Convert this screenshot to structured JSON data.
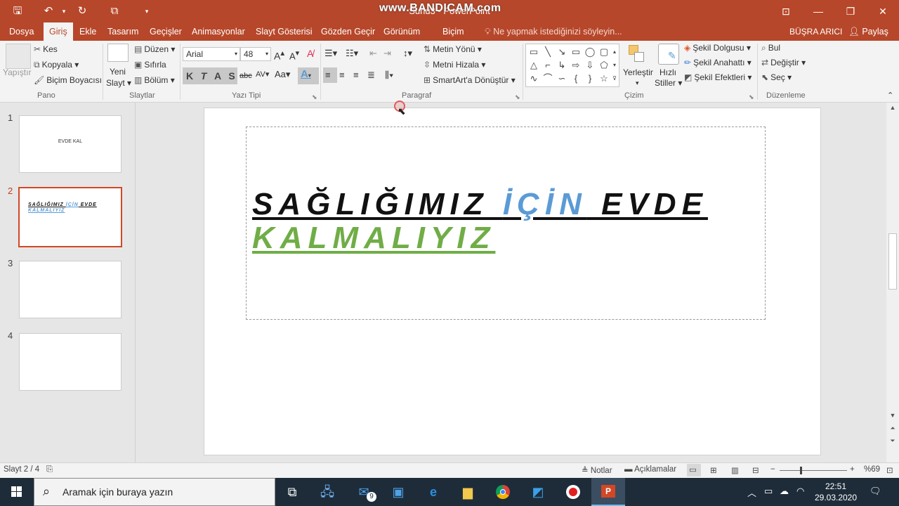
{
  "titlebar": {
    "title": "Sunu3 - PowerPoint",
    "watermark": "www.BANDICAM.com"
  },
  "tabs": [
    {
      "label": "Dosya",
      "active": false
    },
    {
      "label": "Giriş",
      "active": true
    },
    {
      "label": "Ekle",
      "active": false
    },
    {
      "label": "Tasarım",
      "active": false
    },
    {
      "label": "Geçişler",
      "active": false
    },
    {
      "label": "Animasyonlar",
      "active": false
    },
    {
      "label": "Slayt Gösterisi",
      "active": false
    },
    {
      "label": "Gözden Geçir",
      "active": false
    },
    {
      "label": "Görünüm",
      "active": false
    },
    {
      "label": "Biçim",
      "active": false
    }
  ],
  "tellme": "Ne yapmak istediğinizi söyleyin...",
  "user": "BÜŞRA ARICI",
  "share": "Paylaş",
  "ribbon": {
    "pano": {
      "paste": "Yapıştır",
      "cut": "Kes",
      "copy": "Kopyala",
      "format_painter": "Biçim Boyacısı",
      "label": "Pano"
    },
    "slaytlar": {
      "new_slide_1": "Yeni",
      "new_slide_2": "Slayt",
      "layout": "Düzen",
      "reset": "Sıfırla",
      "section": "Bölüm",
      "label": "Slaytlar"
    },
    "yazi_tipi": {
      "font_name": "Arial",
      "font_size": "48",
      "bold": "K",
      "italic": "T",
      "underline": "A",
      "shadow": "S",
      "strike": "abc",
      "spacing": "AV",
      "case": "Aa",
      "font_color": "A",
      "label": "Yazı Tipi"
    },
    "paragraf": {
      "text_direction": "Metin Yönü",
      "align_text": "Metni Hizala",
      "smartart": "SmartArt'a Dönüştür",
      "label": "Paragraf"
    },
    "cizim": {
      "arrange": "Yerleştir",
      "quick_styles_1": "Hızlı",
      "quick_styles_2": "Stiller",
      "shape_fill": "Şekil Dolgusu",
      "shape_outline": "Şekil Anahattı",
      "shape_effects": "Şekil Efektleri",
      "label": "Çizim"
    },
    "duzenleme": {
      "find": "Bul",
      "replace": "Değiştir",
      "select": "Seç",
      "label": "Düzenleme"
    }
  },
  "slides": [
    {
      "number": "1",
      "text": "EVDE KAL"
    },
    {
      "number": "2",
      "line1_black": "SAĞLIĞIMIZ ",
      "line1_blue": "İÇİN",
      "line1_end": " EVDE",
      "line2": "KALMALIYIZ"
    },
    {
      "number": "3"
    },
    {
      "number": "4"
    }
  ],
  "main_slide": {
    "part1": "SAĞLIĞIMIZ ",
    "part2": "İÇİN",
    "part3": " EVDE",
    "line2": "KALMALIYIZ"
  },
  "status": {
    "slide_info": "Slayt 2 / 4",
    "notes": "Notlar",
    "comments": "Açıklamalar",
    "zoom": "%69"
  },
  "taskbar": {
    "search_placeholder": "Aramak için buraya yazın",
    "mail_badge": "9",
    "time": "22:51",
    "date": "29.03.2020"
  },
  "colors": {
    "accent": "#b7472a",
    "blue_text": "#5b9bd5",
    "green_text": "#70ad47"
  }
}
